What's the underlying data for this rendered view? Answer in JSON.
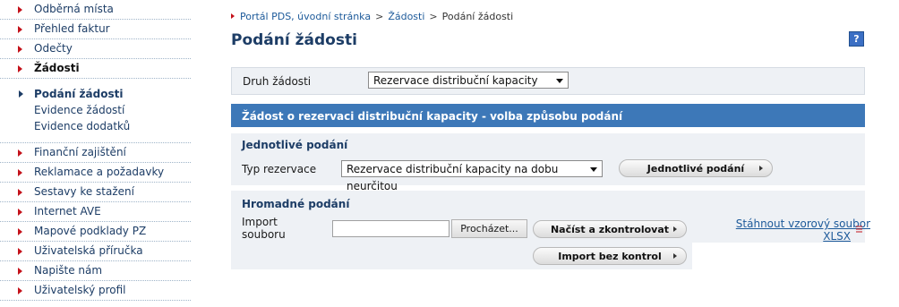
{
  "sidebar": {
    "items_top": [
      {
        "label": "Odběrná místa"
      },
      {
        "label": "Přehled faktur"
      },
      {
        "label": "Odečty"
      },
      {
        "label": "Žádosti"
      }
    ],
    "sub_items": [
      {
        "label": "Podání žádosti"
      },
      {
        "label": "Evidence žádostí"
      },
      {
        "label": "Evidence dodatků"
      }
    ],
    "items_bottom": [
      {
        "label": "Finanční zajištění"
      },
      {
        "label": "Reklamace a požadavky"
      },
      {
        "label": "Sestavy ke stažení"
      },
      {
        "label": "Internet AVE"
      },
      {
        "label": "Mapové podklady PZ"
      },
      {
        "label": "Uživatelská příručka"
      },
      {
        "label": "Napište nám"
      },
      {
        "label": "Uživatelský profil"
      }
    ]
  },
  "breadcrumb": {
    "home": "Portál PDS, úvodní stránka",
    "sep1": ">",
    "level2": "Žádosti",
    "sep2": ">",
    "current": "Podání žádosti"
  },
  "page": {
    "title": "Podání žádosti",
    "help_glyph": "?"
  },
  "request_type": {
    "label": "Druh žádosti",
    "selected": "Rezervace distribuční kapacity"
  },
  "band": {
    "title": "Žádost o rezervaci distribuční kapacity - volba způsobu podání"
  },
  "single": {
    "heading": "Jednotlivé podání",
    "type_label": "Typ rezervace",
    "type_selected": "Rezervace distribuční kapacity na dobu neurčitou",
    "button": "Jednotlivé podání"
  },
  "bulk": {
    "heading": "Hromadné podání",
    "import_label_line1": "Import",
    "import_label_line2": "souboru",
    "browse_button": "Procházet...",
    "load_button": "Načíst a zkontrolovat",
    "import_button": "Import bez kontrol",
    "download_line1": "Stáhnout vzorový soubor",
    "download_line2": "XLSX"
  },
  "colors": {
    "accent": "#3d78b8",
    "arrow": "#c4121b",
    "link": "#1d5a9a"
  }
}
